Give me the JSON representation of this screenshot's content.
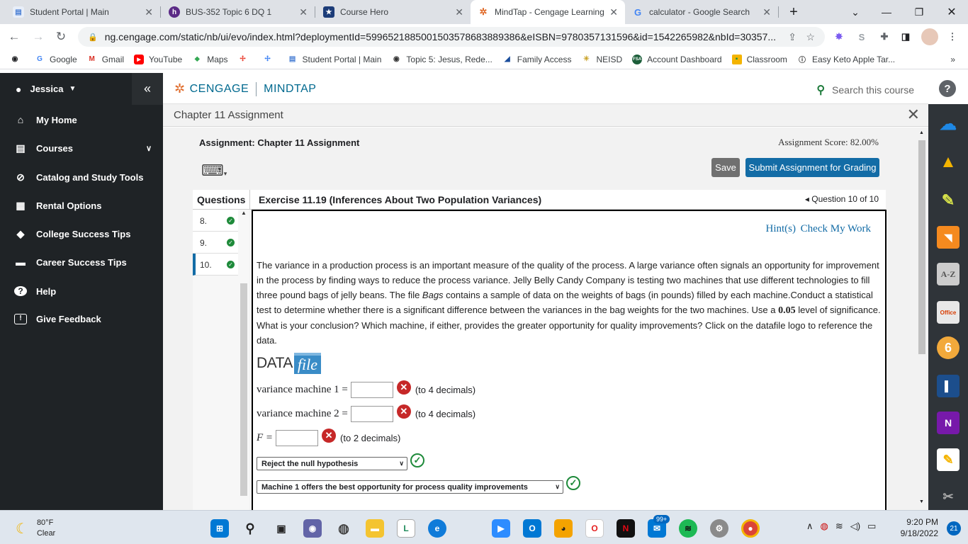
{
  "browser": {
    "tabs": [
      {
        "title": "Student Portal | Main",
        "icon_color": "#4a7fd4",
        "icon": "portal-icon"
      },
      {
        "title": "BUS-352 Topic 6 DQ 1",
        "icon_color": "#5b2a86",
        "icon": "halo-icon"
      },
      {
        "title": "Course Hero",
        "icon_color": "#1c3c78",
        "icon": "star-icon"
      },
      {
        "title": "MindTap - Cengage Learning",
        "icon_color": "#e06b2a",
        "icon": "cengage-icon"
      },
      {
        "title": "calculator - Google Search",
        "icon_color": "#4285f4",
        "icon": "google-icon"
      }
    ],
    "new_tab": "+",
    "url": "ng.cengage.com/static/nb/ui/evo/index.html?deploymentId=5996521885001503578683889386&eISBN=9780357131596&id=1542265982&nbId=30357...",
    "bookmarks": [
      "Google",
      "Gmail",
      "YouTube",
      "Maps",
      "Student Portal | Main",
      "Topic 5: Jesus, Rede...",
      "Family Access",
      "NEISD",
      "Account Dashboard",
      "Classroom",
      "Easy Keto Apple Tar..."
    ],
    "bookmarks_more": "»"
  },
  "sidebar": {
    "user": "Jessica",
    "collapse": "«",
    "items": [
      {
        "label": "My Home",
        "icon": "home-icon",
        "glyph": "⌂"
      },
      {
        "label": "Courses",
        "icon": "book-icon",
        "glyph": "▤"
      },
      {
        "label": "Catalog and Study Tools",
        "icon": "compass-icon",
        "glyph": "⊘"
      },
      {
        "label": "Rental Options",
        "icon": "calendar-icon",
        "glyph": "▦"
      },
      {
        "label": "College Success Tips",
        "icon": "graduation-cap-icon",
        "glyph": "◆"
      },
      {
        "label": "Career Success Tips",
        "icon": "briefcase-icon",
        "glyph": "▬"
      },
      {
        "label": "Help",
        "icon": "help-icon",
        "glyph": "?"
      },
      {
        "label": "Give Feedback",
        "icon": "feedback-icon",
        "glyph": "!"
      }
    ]
  },
  "header": {
    "brand_left": "CENGAGE",
    "brand_right": "MINDTAP",
    "search_placeholder": "Search this course",
    "help": "?"
  },
  "chapter": {
    "title": "Chapter 11 Assignment",
    "close": "✕"
  },
  "assignment": {
    "title": "Assignment: Chapter 11 Assignment",
    "score": "Assignment Score: 82.00%",
    "save": "Save",
    "submit": "Submit Assignment for Grading",
    "questions_label": "Questions",
    "exercise_title": "Exercise 11.19 (Inferences About Two Population Variances)",
    "question_nav": "◂ Question 10 of 10",
    "question_list": [
      {
        "num": "8.",
        "complete": true
      },
      {
        "num": "9.",
        "complete": true
      },
      {
        "num": "10.",
        "complete": true
      }
    ],
    "hint": "Hint(s)",
    "check": "Check My Work",
    "question_text_parts": [
      "The variance in a production process is an important measure of the quality of the process. A large variance often signals an opportunity for improvement in the process by finding ways to reduce the process variance. Jelly Belly Candy Company is testing two machines that use different technologies to fill three pound bags of jelly beans. The file ",
      "Bags",
      " contains a sample of data on the weights of bags (in pounds) filled by each machine.Conduct a statistical test to determine whether there is a significant difference between the variances in the bag weights for the two machines. Use a ",
      "0.05",
      " level of significance. What is your conclusion? Which machine, if either, provides the greater opportunity for quality improvements? Click on the datafile logo to reference the data."
    ],
    "datafile_data": "DATA",
    "datafile_file": "file",
    "answers": [
      {
        "label": "variance machine 1 =",
        "value": "",
        "hint": "(to 4 decimals)",
        "correct": false
      },
      {
        "label": "variance machine 2 =",
        "value": "",
        "hint": "(to 4 decimals)",
        "correct": false
      },
      {
        "label": "F =",
        "value": "",
        "hint": "(to 2 decimals)",
        "correct": false
      }
    ],
    "select_1": "Reject the null hypothesis",
    "select_2": "Machine 1 offers the best opportunity for process quality improvements"
  },
  "taskbar": {
    "temp": "80°F",
    "condition": "Clear",
    "time": "9:20 PM",
    "date": "9/18/2022",
    "notifications": "21",
    "mail_badge": "99+"
  }
}
